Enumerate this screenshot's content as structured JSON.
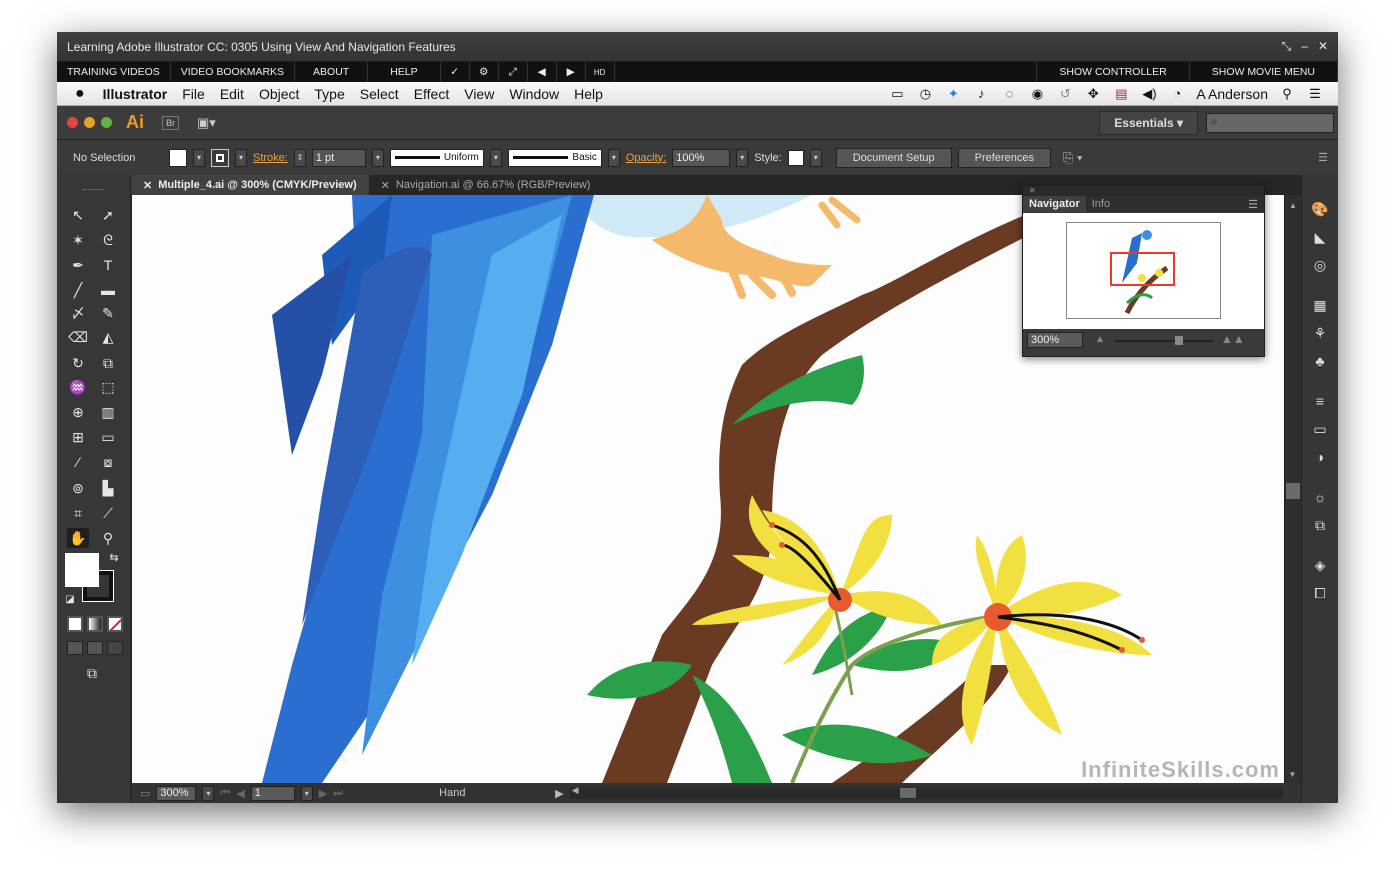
{
  "window": {
    "title": "Learning Adobe Illustrator CC: 0305 Using View And Navigation Features"
  },
  "player": {
    "training_videos": "TRAINING VIDEOS",
    "video_bookmarks": "VIDEO BOOKMARKS",
    "about": "ABOUT",
    "help": "HELP",
    "check": "✓",
    "gear": "⚙",
    "expand": "⤢",
    "prev": "◀",
    "next": "▶",
    "hd": "HD",
    "show_controller": "SHOW CONTROLLER",
    "show_movie_menu": "SHOW MOVIE MENU"
  },
  "menubar": {
    "apple": "",
    "app_name": "Illustrator",
    "items": [
      "File",
      "Edit",
      "Object",
      "Type",
      "Select",
      "Effect",
      "View",
      "Window",
      "Help"
    ],
    "user": "A Anderson"
  },
  "appbar": {
    "logo": "Ai",
    "bridge": "Br",
    "workspace": "Essentials",
    "search_placeholder": "⌕"
  },
  "controlbar": {
    "selection": "No Selection",
    "stroke_label": "Stroke:",
    "stroke_weight": "1 pt",
    "profile": "Uniform",
    "brush": "Basic",
    "opacity_label": "Opacity:",
    "opacity_value": "100%",
    "style_label": "Style:",
    "doc_setup": "Document Setup",
    "preferences": "Preferences"
  },
  "tabs": [
    {
      "label": "Multiple_4.ai @ 300% (CMYK/Preview)",
      "active": true
    },
    {
      "label": "Navigation.ai @ 66.67% (RGB/Preview)",
      "active": false
    }
  ],
  "navigator": {
    "tab_navigator": "Navigator",
    "tab_info": "Info",
    "zoom": "300%"
  },
  "status": {
    "zoom": "300%",
    "artboard": "1",
    "tool": "Hand"
  },
  "watermark": "InfiniteSkills.com"
}
